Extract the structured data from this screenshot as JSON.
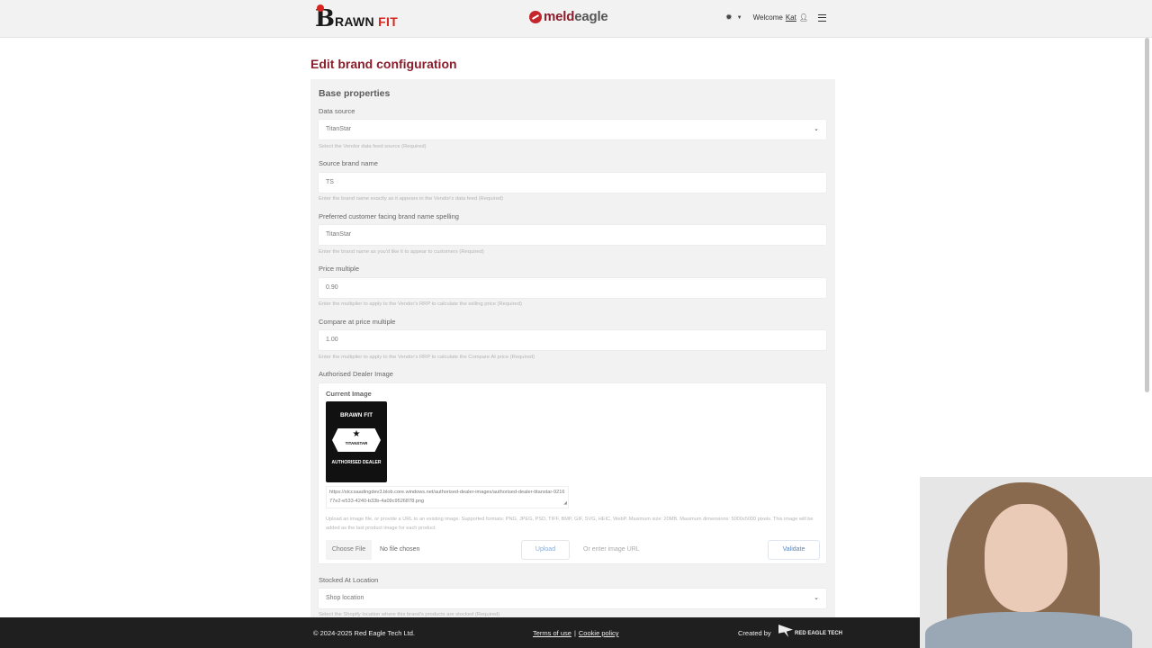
{
  "header": {
    "brand_logo_b": "B",
    "brand_logo_rawn": "RAWN ",
    "brand_logo_fit": "FIT",
    "meld_logo_meld": "meld",
    "meld_logo_eagle": "eagle",
    "welcome_prefix": "Welcome",
    "user_name": "Kat"
  },
  "page": {
    "title": "Edit brand configuration"
  },
  "base_properties": {
    "section_title": "Base properties",
    "data_source": {
      "label": "Data source",
      "value": "TitanStar",
      "help": "Select the Vendor data feed source (Required)"
    },
    "source_brand_name": {
      "label": "Source brand name",
      "value": "TS",
      "help": "Enter the brand name exactly as it appears in the Vendor's data feed (Required)"
    },
    "preferred_name": {
      "label": "Preferred customer facing brand name spelling",
      "value": "TitanStar",
      "help": "Enter the brand name as you'd like it to appear to customers (Required)"
    },
    "price_multiple": {
      "label": "Price multiple",
      "value": "0.90",
      "help": "Enter the multiplier to apply to the Vendor's RRP to calculate the selling price (Required)"
    },
    "compare_multiple": {
      "label": "Compare at price multiple",
      "value": "1.00",
      "help": "Enter the multiplier to apply to the Vendor's RRP to calculate the Compare At price (Required)"
    },
    "dealer_image": {
      "label": "Authorised Dealer Image",
      "current_label": "Current Image",
      "img_brand": "BRAWN FIT",
      "img_badge": "TITANSTAR",
      "img_caption": "AUTHORISED DEALER",
      "url": "https://stccsaadingdev3.blob.core.windows.net/authorised-dealer-images/authorised-dealer-titanstar-921677e2-e533-4240-b33b-4a09c9526878.png",
      "help": "Upload an image file, or provide a URL to an existing image. Supported formats: PNG, JPEG, PSD, TIFF, BMP, GIF, SVG, HEIC, WebP. Maximum size: 20MB. Maximum dimensions: 5000x5000 pixels. This image will be added as the last product image for each product.",
      "choose_file": "Choose File",
      "no_file": "No file chosen",
      "upload": "Upload",
      "url_placeholder": "Or enter image URL",
      "validate": "Validate"
    },
    "stocked_location": {
      "label": "Stocked At Location",
      "value": "Shop location",
      "help": "Select the Shopify location where this brand's products are stocked (Required)"
    }
  },
  "footer": {
    "copyright": "© 2024-2025 Red Eagle Tech Ltd.",
    "terms": "Terms of use",
    "separator": "|",
    "cookie": "Cookie policy",
    "created_by": "Created by",
    "ret_logo_text": "RED EAGLE TECH"
  },
  "colors": {
    "accent": "#8b1e2d",
    "brand_red": "#d8261f",
    "footer_bg": "#1f1f1f"
  }
}
